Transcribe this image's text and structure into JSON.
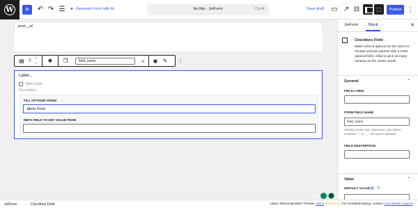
{
  "toolbar": {
    "add_label": "+",
    "generate_label": "Generate Form with AI",
    "doc_title": "No title · JetForm",
    "shortcut": "Ctrl+K",
    "save_draft": "Save draft",
    "publish": "Publish"
  },
  "canvas": {
    "post_id": "post__id",
    "block_toolbar": {
      "field_name": "field_name"
    },
    "field": {
      "label": "Label...",
      "check_label": "Meta Field",
      "description": "Description...",
      "fill_options_head": "FILL OPTIONS FROM",
      "fill_options_value": "Meta Field",
      "meta_field_head": "META FIELD TO GET VALUE FROM",
      "meta_field_value": ""
    }
  },
  "sidebar": {
    "tabs": [
      "JetForm",
      "Block"
    ],
    "active_tab": "Block",
    "card": {
      "title": "Checkbox Field",
      "description": "Make a list of options for the users to choose several variants with a multi-optional field. Allow to pick as many variants as the visitor needs."
    },
    "general": {
      "heading": "General",
      "field_label": "FIELD LABEL",
      "field_label_value": "",
      "form_field_name": "FORM FIELD NAME",
      "form_field_name_value": "field_name",
      "name_help": "Should contain only lowercase Latin letters, numbers, \"-\" or \"_\". No spaces allowed.",
      "field_description": "FIELD DESCRIPTION",
      "field_description_value": ""
    },
    "value": {
      "heading": "Value",
      "default_value": "DEFAULT VALUE"
    }
  },
  "footer": {
    "breadcrumb": [
      "JetForm",
      "Checkbox Field"
    ],
    "note_prefix": "Liked JetFormBuilder? Please ",
    "rate_link": "rate it",
    "stars": "★★★★★",
    "note_mid": ". For troubleshooting, contact ",
    "support_link": "Crocoblock support",
    "note_end": "."
  },
  "colors": {
    "accent": "#3858e9",
    "dark": "#1e1e1e",
    "canvas_bg": "#f0f0f0",
    "green": "#0a875a"
  }
}
